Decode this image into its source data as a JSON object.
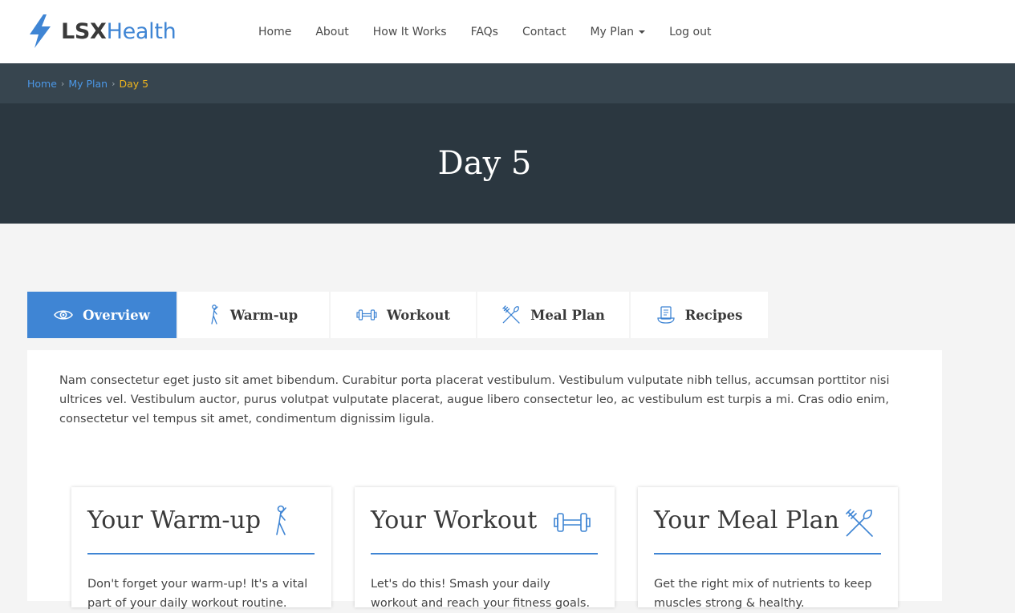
{
  "brand": {
    "lsx": "LSX",
    "health": "Health"
  },
  "nav": {
    "items": [
      "Home",
      "About",
      "How It Works",
      "FAQs",
      "Contact",
      "My Plan",
      "Log out"
    ]
  },
  "breadcrumb": {
    "home": "Home",
    "plan": "My Plan",
    "current": "Day 5"
  },
  "hero": {
    "title": "Day 5"
  },
  "tabs": [
    {
      "label": "Overview",
      "icon": "eye-icon",
      "active": true
    },
    {
      "label": "Warm-up",
      "icon": "stretching-person-icon",
      "active": false
    },
    {
      "label": "Workout",
      "icon": "dumbbell-icon",
      "active": false
    },
    {
      "label": "Meal Plan",
      "icon": "fork-knife-icon",
      "active": false
    },
    {
      "label": "Recipes",
      "icon": "recipe-book-icon",
      "active": false
    }
  ],
  "intro": "Nam consectetur eget justo sit amet bibendum. Curabitur porta placerat vestibulum. Vestibulum vulputate nibh tellus, accumsan porttitor nisi ultrices vel. Vestibulum auctor, purus volutpat vulputate placerat, augue libero consectetur leo, ac vestibulum est turpis a mi. Cras odio enim, consectetur vel tempus sit amet, condimentum dignissim ligula.",
  "cards": [
    {
      "title": "Your Warm-up",
      "icon": "stretching-person-icon",
      "text": "Don't forget your warm-up! It's a vital part of your daily workout routine."
    },
    {
      "title": "Your Workout",
      "icon": "dumbbell-icon",
      "text": "Let's do this! Smash your daily workout and reach your fitness goals."
    },
    {
      "title": "Your Meal Plan",
      "icon": "fork-knife-icon",
      "text": "Get the right mix of nutrients to keep muscles strong & healthy."
    }
  ],
  "colors": {
    "accent": "#3f85d4",
    "breadcrumb_current": "#f0b51d",
    "hero_bg": "#2b3740",
    "breadcrumb_bg": "#37454f"
  }
}
